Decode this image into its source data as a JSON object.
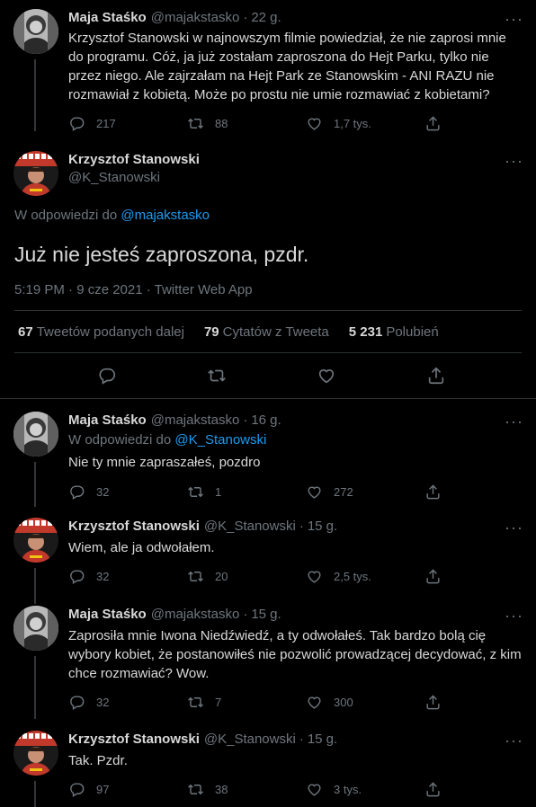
{
  "tweets": [
    {
      "name": "Maja Staśko",
      "handle": "@majakstasko",
      "time": "22 g.",
      "text": "Krzysztof Stanowski w najnowszym filmie powiedział, że nie zaprosi mnie do programu. Cóż, ja już zostałam zaproszona do Hejt Parku, tylko nie przez niego. Ale zajrzałam na Hejt Park ze Stanowskim - ANI RAZU nie rozmawiał z kobietą. Może po prostu nie umie rozmawiać z kobietami?",
      "replies": "217",
      "retweets": "88",
      "likes": "1,7 tys."
    },
    {
      "name": "Maja Staśko",
      "handle": "@majakstasko",
      "time": "16 g.",
      "reply_prefix": "W odpowiedzi do",
      "reply_to": "@K_Stanowski",
      "text": "Nie ty mnie zapraszałeś, pozdro",
      "replies": "32",
      "retweets": "1",
      "likes": "272"
    },
    {
      "name": "Krzysztof Stanowski",
      "handle": "@K_Stanowski",
      "time": "15 g.",
      "text": "Wiem, ale ja odwołałem.",
      "replies": "32",
      "retweets": "20",
      "likes": "2,5 tys."
    },
    {
      "name": "Maja Staśko",
      "handle": "@majakstasko",
      "time": "15 g.",
      "text": "Zaprosiła mnie Iwona Niedźwiedź, a ty odwołałeś. Tak bardzo bolą cię wybory kobiet, że postanowiłeś nie pozwolić prowadzącej decydować, z kim chce rozmawiać? Wow.",
      "replies": "32",
      "retweets": "7",
      "likes": "300"
    },
    {
      "name": "Krzysztof Stanowski",
      "handle": "@K_Stanowski",
      "time": "15 g.",
      "text": "Tak. Pzdr.",
      "replies": "97",
      "retweets": "38",
      "likes": "3 tys."
    }
  ],
  "main": {
    "name": "Krzysztof Stanowski",
    "handle": "@K_Stanowski",
    "reply_prefix": "W odpowiedzi do",
    "reply_to": "@majakstasko",
    "text": "Już nie jesteś zaproszona, pzdr.",
    "timestamp": "5:19 PM · 9 cze 2021 · Twitter Web App",
    "retweets_count": "67",
    "retweets_label": "Tweetów podanych dalej",
    "quotes_count": "79",
    "quotes_label": "Cytatów z Tweeta",
    "likes_count": "5 231",
    "likes_label": "Polubień"
  },
  "more_glyph": "···",
  "dot_glyph": "·",
  "colors": {
    "background": "#000000",
    "text": "#d9d9d9",
    "muted": "#6e767d",
    "link": "#1d9bf0",
    "border": "#2f3336"
  }
}
